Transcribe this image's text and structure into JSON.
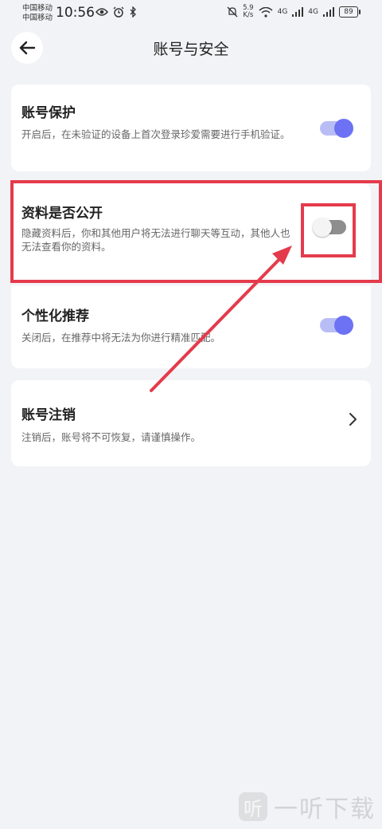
{
  "status_bar": {
    "carrier_1": "中国移动",
    "carrier_2": "中国移动",
    "time": "10:56",
    "net_speed_value": "5.9",
    "net_speed_unit": "K/s",
    "signal_1_label": "4G",
    "signal_2_label": "4G",
    "battery": "89"
  },
  "header": {
    "title": "账号与安全"
  },
  "settings": {
    "account_protection": {
      "title": "账号保护",
      "description": "开启后，在未验证的设备上首次登录珍爱需要进行手机验证。",
      "enabled": true
    },
    "profile_public": {
      "title": "资料是否公开",
      "description": "隐藏资料后，你和其他用户将无法进行聊天等互动，其他人也无法查看你的资料。",
      "enabled": false
    },
    "personalized_recommendation": {
      "title": "个性化推荐",
      "description": "关闭后，在推荐中将无法为你进行精准匹配。",
      "enabled": true
    },
    "account_cancellation": {
      "title": "账号注销",
      "description": "注销后，账号将不可恢复，请谨慎操作。"
    }
  },
  "colors": {
    "accent": "#6c72f3",
    "annotation": "#e43b4c"
  },
  "watermark": {
    "logo_char": "听",
    "text": "一听下载"
  }
}
